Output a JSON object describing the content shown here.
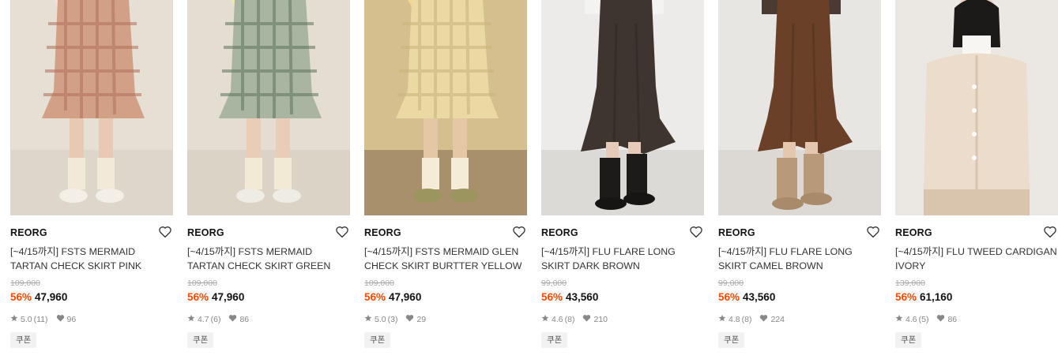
{
  "products": [
    {
      "brand": "REORG",
      "title": "[~4/15까지] FSTS MERMAID TARTAN CHECK SKIRT PINK",
      "original_price": "109,000",
      "discount": "56%",
      "price": "47,960",
      "rating": "5.0",
      "reviews": "(11)",
      "likes": "96",
      "coupon": "쿠폰",
      "colors": {
        "bg": "#e6dfd3",
        "floor": "#ddd6ca",
        "garment": "#d2a086",
        "pattern": "#b3705a",
        "top": "#f6dfd8",
        "sock": "#f2e9d8",
        "shoe": "#f3eee6",
        "skin": "#e8c9b4"
      }
    },
    {
      "brand": "REORG",
      "title": "[~4/15까지] FSTS MERMAID TARTAN CHECK SKIRT GREEN",
      "original_price": "109,000",
      "discount": "56%",
      "price": "47,960",
      "rating": "4.7",
      "reviews": "(6)",
      "likes": "86",
      "coupon": "쿠폰",
      "colors": {
        "bg": "#e4ddd1",
        "floor": "#dad3c6",
        "garment": "#a9b5a0",
        "pattern": "#5e7560",
        "top": "#f5e6a8",
        "sock": "#f3ead5",
        "shoe": "#efece5",
        "skin": "#e9cdb6"
      }
    },
    {
      "brand": "REORG",
      "title": "[~4/15까지] FSTS MERMAID GLEN CHECK SKIRT BURTTER YELLOW",
      "original_price": "109,000",
      "discount": "56%",
      "price": "47,960",
      "rating": "5.0",
      "reviews": "(3)",
      "likes": "29",
      "coupon": "쿠폰",
      "colors": {
        "bg": "#d6bf8f",
        "floor": "#a8906d",
        "garment": "#ead9a3",
        "pattern": "#c9b37a",
        "top": "#f0d88e",
        "sock": "#f4ecd6",
        "shoe": "#9c9560",
        "skin": "#e6c7a5"
      }
    },
    {
      "brand": "REORG",
      "title": "[~4/15까지] FLU FLARE LONG SKIRT DARK BROWN",
      "original_price": "99,000",
      "discount": "56%",
      "price": "43,560",
      "rating": "4.6",
      "reviews": "(8)",
      "likes": "210",
      "coupon": "쿠폰",
      "colors": {
        "bg": "#ecebea",
        "floor": "#dcdad7",
        "garment": "#3e352f",
        "pattern": "#2d2621",
        "top": "#f3f3f1",
        "sock": "#1d1b1a",
        "shoe": "#161514",
        "skin": "#e5cbb8"
      }
    },
    {
      "brand": "REORG",
      "title": "[~4/15까지] FLU FLARE LONG SKIRT CAMEL BROWN",
      "original_price": "99,000",
      "discount": "56%",
      "price": "43,560",
      "rating": "4.8",
      "reviews": "(8)",
      "likes": "224",
      "coupon": "쿠폰",
      "colors": {
        "bg": "#e8e6e3",
        "floor": "#dcd9d5",
        "garment": "#6a4128",
        "pattern": "#4f2f1d",
        "top": "#4a3a33",
        "sock": "#b8997a",
        "shoe": "#a98b6b",
        "skin": "#e5c6ae"
      }
    },
    {
      "brand": "REORG",
      "title": "[~4/15까지] FLU TWEED CARDIGAN IVORY",
      "original_price": "139,000",
      "discount": "56%",
      "price": "61,160",
      "rating": "4.6",
      "reviews": "(5)",
      "likes": "86",
      "coupon": "쿠폰",
      "colors": {
        "bg": "#ebe7e2",
        "floor": "#e4ded7",
        "garment": "#ecdccb",
        "pattern": "#d9c4ad",
        "top": "#f7f6f3",
        "sock": "#ecdccb",
        "shoe": "#ecdccb",
        "skin": "#ecd2bf"
      }
    }
  ]
}
